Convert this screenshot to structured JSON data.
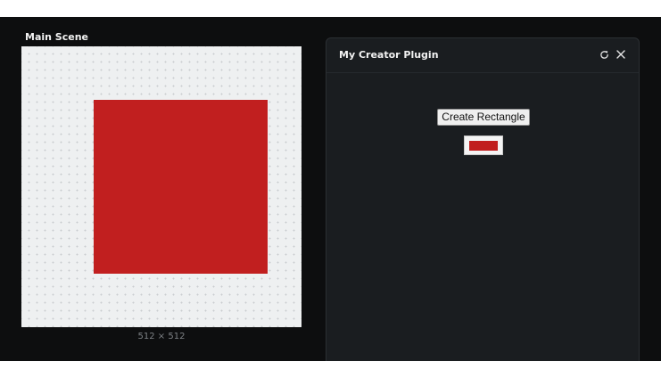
{
  "scene": {
    "title": "Main Scene",
    "canvas_size": "512 × 512",
    "rectangle_color": "#c11f1f",
    "canvas_background": "#eef0f1"
  },
  "plugin": {
    "title": "My Creator Plugin",
    "refresh_icon": "refresh-icon",
    "close_icon": "close-icon",
    "create_button_label": "Create Rectangle",
    "preview_color": "#c11f1f"
  },
  "colors": {
    "app_background": "#0d0e0f",
    "panel_background": "#1a1d20"
  }
}
